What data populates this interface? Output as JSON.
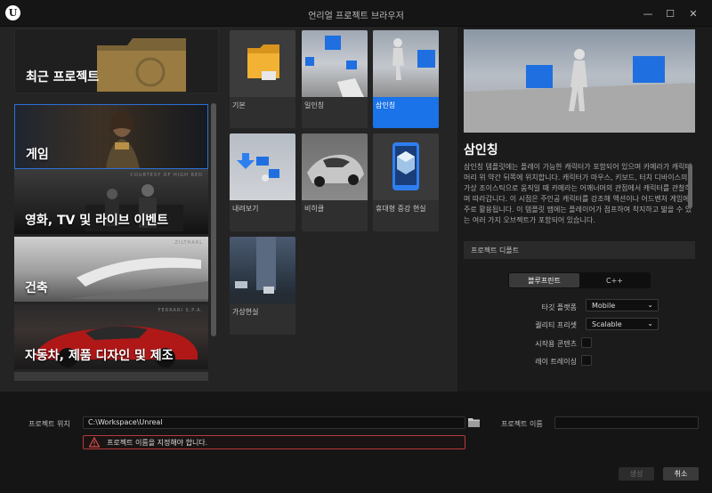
{
  "window": {
    "title": "언리얼 프로젝트 브라우저",
    "logo_letter": "U",
    "controls": {
      "minimize": "—",
      "maximize": "☐",
      "close": "✕"
    }
  },
  "categories": {
    "recent": "최근 프로젝트",
    "items": [
      {
        "label": "게임",
        "selected": true,
        "tag": ""
      },
      {
        "label": "영화, TV 및 라이브 이벤트",
        "selected": false,
        "tag": "COURTESY OF HIGH RED"
      },
      {
        "label": "건축",
        "selected": false,
        "tag": "ZILTHARL"
      },
      {
        "label": "자동차, 제품 디자인 및 제조",
        "selected": false,
        "tag": "FERRARI S.P.A."
      }
    ]
  },
  "templates": [
    {
      "label": "기본",
      "selected": false
    },
    {
      "label": "일인칭",
      "selected": false
    },
    {
      "label": "삼인칭",
      "selected": true
    },
    {
      "label": "내려보기",
      "selected": false
    },
    {
      "label": "비히클",
      "selected": false
    },
    {
      "label": "휴대형 증강 현실",
      "selected": false
    },
    {
      "label": "가상현실",
      "selected": false
    }
  ],
  "details": {
    "title": "삼인칭",
    "description": "삼인칭 템플릿에는 플레이 가능한 캐릭터가 포함되어 있으며 카메라가 캐릭터 머리 위 약간 뒤쪽에 위치합니다. 캐릭터가 마우스, 키보드, 터치 디바이스의 가상 조이스틱으로 움직일 때 카메라는 어깨너머의 관점에서 캐릭터를 관찰하며 따라갑니다. 이 시점은 주인공 캐릭터를 강조해 액션이나 어드벤처 게임에 주로 활용됩니다. 이 템플릿 맵에는 플레이어가 점프하여 착지하고 밟을 수 있는 여러 가지 오브젝트가 포함되어 있습니다.",
    "defaults_header": "프로젝트 디폴트",
    "language_options": [
      "블루프린트",
      "C++"
    ],
    "language_selected": "블루프린트",
    "target_platform_label": "타깃 플랫폼",
    "target_platform_value": "Mobile",
    "quality_label": "퀄리티 프리셋",
    "quality_value": "Scalable",
    "starter_label": "시작용 콘텐츠",
    "starter_checked": false,
    "raytracing_label": "레이 트레이싱",
    "raytracing_checked": false
  },
  "footer": {
    "location_label": "프로젝트 위치",
    "location_value": "C:\\Workspace\\Unreal",
    "name_label": "프로젝트 이름",
    "name_value": "",
    "error_text": "프로젝트 이름을 지정해야 합니다.",
    "create_label": "생성",
    "cancel_label": "취소"
  },
  "colors": {
    "accent": "#1a73e8",
    "error": "#b63a3a",
    "background": "#242424"
  },
  "icons": [
    "unreal-logo-icon",
    "minimize-icon",
    "maximize-icon",
    "close-icon",
    "folder-browse-icon",
    "warning-icon",
    "chevron-down-icon"
  ]
}
